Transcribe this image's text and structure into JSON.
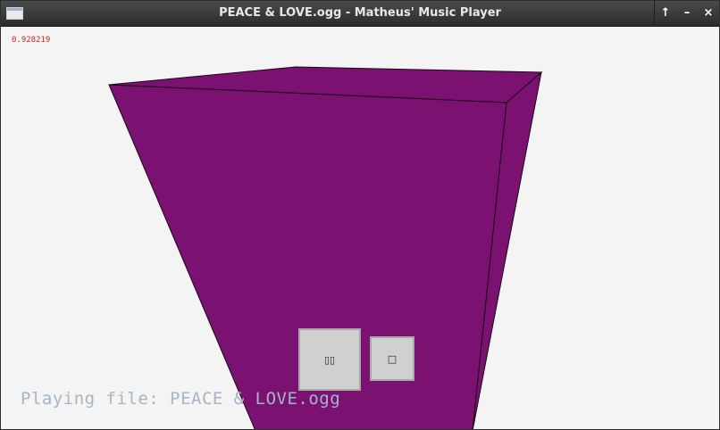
{
  "window": {
    "title": "PEACE & LOVE.ogg - Matheus' Music Player",
    "controls": {
      "maximize": "↑",
      "minimize": "–",
      "close": "×"
    }
  },
  "viewport": {
    "fps_readout": "0.928219",
    "cube_color": "#7b1170"
  },
  "controls": {
    "play_pause_label": "▯▯",
    "stop_label": "□"
  },
  "status": {
    "text": "Playing file: PEACE & LOVE.ogg"
  }
}
